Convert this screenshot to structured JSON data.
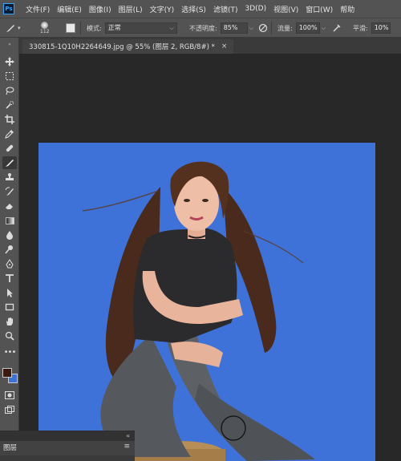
{
  "app": {
    "logo": "Ps"
  },
  "menu": [
    "文件(F)",
    "编辑(E)",
    "图像(I)",
    "图层(L)",
    "文字(Y)",
    "选择(S)",
    "滤镜(T)",
    "3D(D)",
    "视图(V)",
    "窗口(W)",
    "帮助"
  ],
  "options": {
    "brush_size": "112",
    "mode_label": "模式:",
    "mode_value": "正常",
    "opacity_label": "不透明度:",
    "opacity_value": "85%",
    "flow_label": "流量:",
    "flow_value": "100%",
    "smoothing_label": "平滑:",
    "smoothing_value": "10%"
  },
  "document": {
    "tab_title": "330815-1Q10H2264649.jpg @ 55% (图层 2, RGB/8#) *",
    "close": "×"
  },
  "tools": [
    "move-icon",
    "marquee-icon",
    "lasso-icon",
    "quick-select-icon",
    "crop-icon",
    "eyedropper-icon",
    "healing-icon",
    "brush-icon",
    "stamp-icon",
    "history-brush-icon",
    "eraser-icon",
    "gradient-icon",
    "blur-icon",
    "dodge-icon",
    "pen-icon",
    "type-icon",
    "path-select-icon",
    "rectangle-icon",
    "hand-icon",
    "zoom-icon",
    "more-tools-icon"
  ],
  "colors": {
    "foreground": "#3b1a12",
    "background": "#3f72d8",
    "canvas_bg": "#3f72d8"
  },
  "panel": {
    "title": "图层",
    "menu": "≡",
    "close": "«"
  }
}
